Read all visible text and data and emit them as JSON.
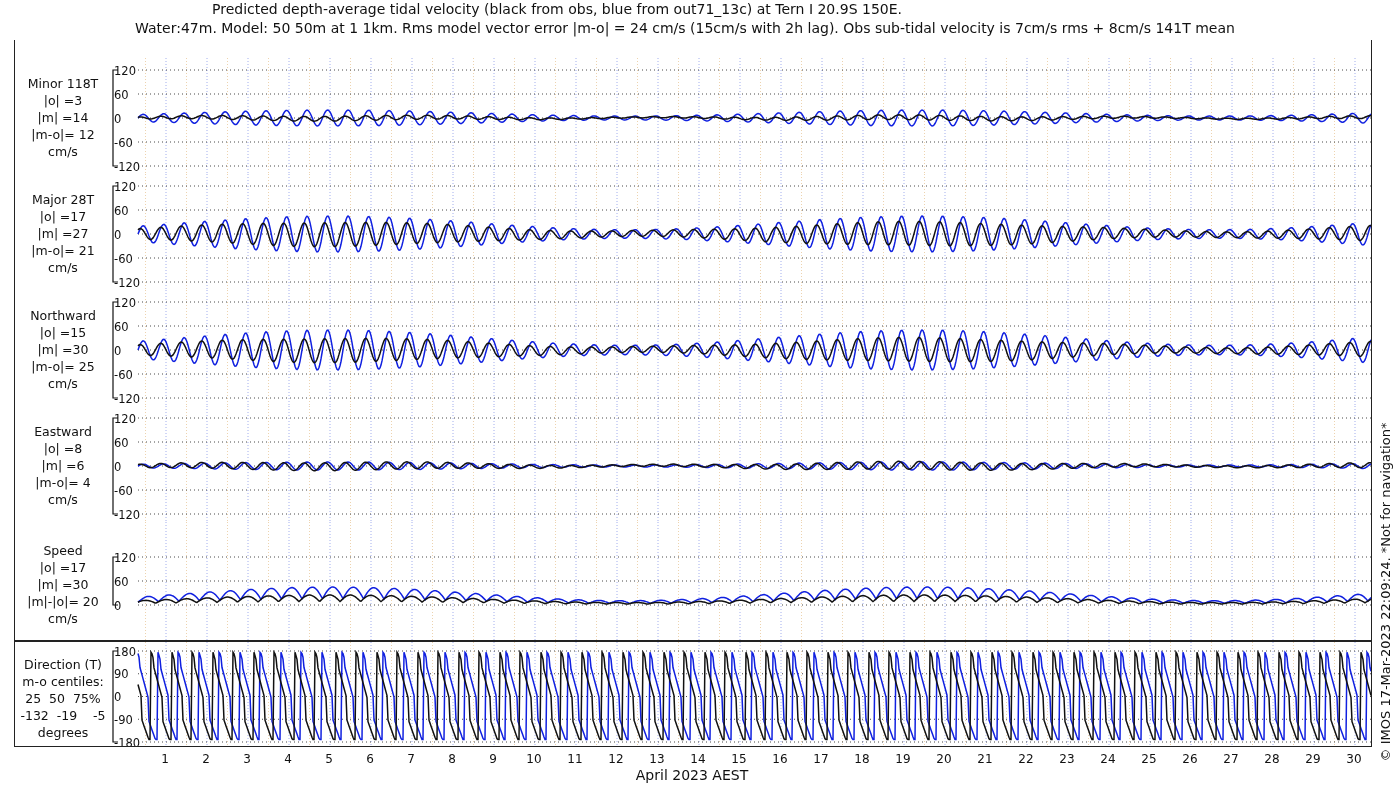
{
  "title": "Predicted depth-average tidal velocity (black from obs, blue from out71_13c) at Tern I 20.9S 150E.",
  "subtitle": "Water:47m. Model: 50 50m at 1 1km. Rms model vector error |m-o| = 24 cm/s (15cm/s with 2h lag). Obs sub-tidal velocity is 7cm/s rms + 8cm/s 141T mean",
  "panels": [
    {
      "kind": "velocity",
      "label_lines": [
        "Minor 118T",
        "|o| =3",
        "|m| =14",
        "|m-o|= 12",
        "cm/s"
      ],
      "yticks": [
        "120",
        "60",
        "0",
        "-60",
        "-120"
      ]
    },
    {
      "kind": "velocity",
      "label_lines": [
        "Major 28T",
        "|o| =17",
        "|m| =27",
        "|m-o|= 21",
        "cm/s"
      ],
      "yticks": [
        "120",
        "60",
        "0",
        "-60",
        "-120"
      ]
    },
    {
      "kind": "velocity",
      "label_lines": [
        "Northward",
        "|o| =15",
        "|m| =30",
        "|m-o|= 25",
        "cm/s"
      ],
      "yticks": [
        "120",
        "60",
        "0",
        "-60",
        "-120"
      ]
    },
    {
      "kind": "velocity",
      "label_lines": [
        "Eastward",
        "|o| =8",
        "|m| =6",
        "|m-o|= 4",
        "cm/s"
      ],
      "yticks": [
        "120",
        "60",
        "0",
        "-60",
        "-120"
      ]
    },
    {
      "kind": "speed",
      "label_lines": [
        "Speed",
        "|o| =17",
        "|m| =30",
        "|m|-|o|= 20",
        "cm/s"
      ],
      "yticks": [
        "120",
        "60",
        "0"
      ]
    },
    {
      "kind": "direction",
      "label_lines": [
        "Direction (T)",
        "m-o centiles:",
        "25  50  75%",
        "-132  -19    -5",
        "degrees"
      ],
      "yticks": [
        "180",
        "90",
        "0",
        "-90",
        "-180"
      ]
    }
  ],
  "x_axis": {
    "ticks": [
      "1",
      "2",
      "3",
      "4",
      "5",
      "6",
      "7",
      "8",
      "9",
      "10",
      "11",
      "12",
      "13",
      "14",
      "15",
      "16",
      "17",
      "18",
      "19",
      "20",
      "21",
      "22",
      "23",
      "24",
      "25",
      "26",
      "27",
      "28",
      "29",
      "30"
    ],
    "label": "April 2023 AEST"
  },
  "credit": "© IMOS 17-Mar-2023 22:09:24. *Not for navigation*"
}
